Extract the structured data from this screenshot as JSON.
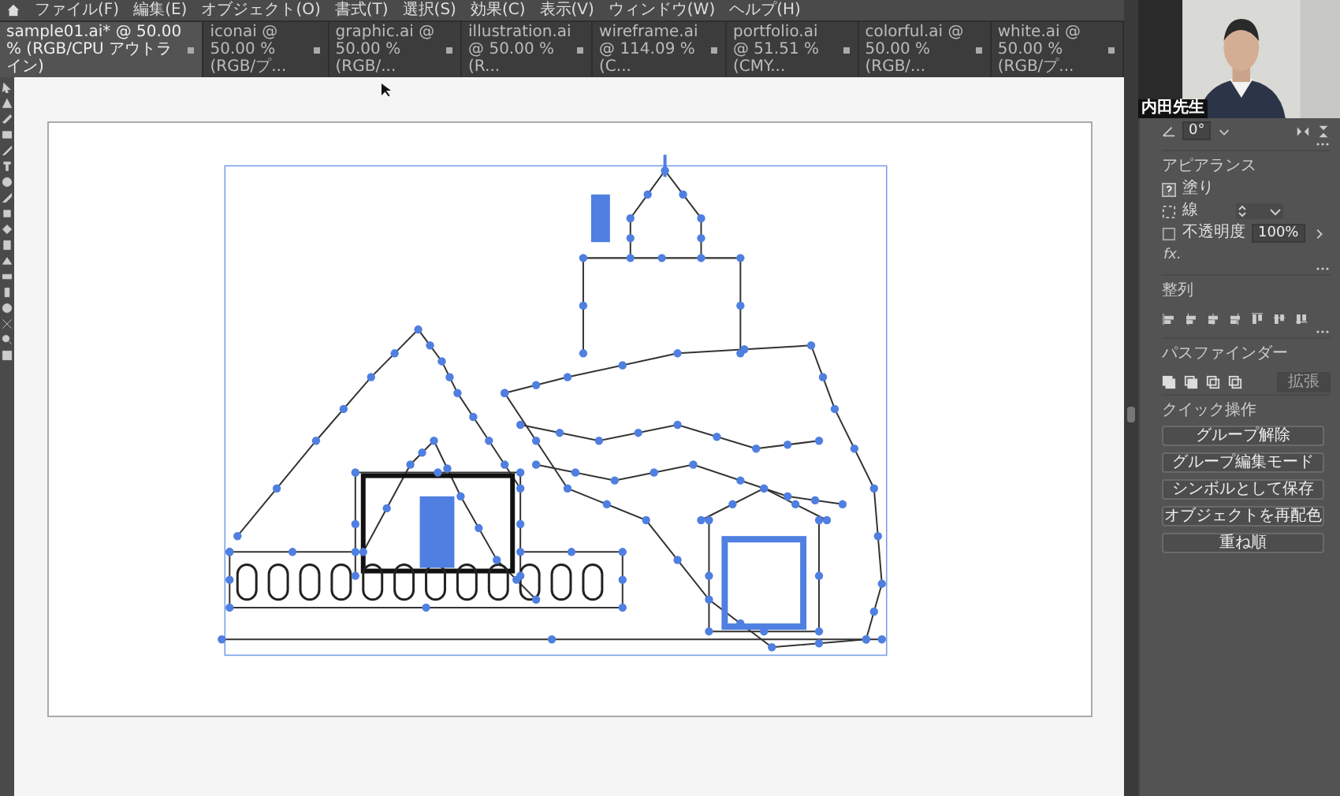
{
  "menu_bar": {
    "items": [
      "ファイル(F)",
      "編集(E)",
      "オブジェクト(O)",
      "書式(T)",
      "選択(S)",
      "効果(C)",
      "表示(V)",
      "ウィンドウ(W)",
      "ヘルプ(H)"
    ]
  },
  "document_tabs": [
    {
      "label": "sample01.ai* @ 50.00 % (RGB/CPU アウトライン)",
      "selected": true
    },
    {
      "label": "iconai @ 50.00 % (RGB/プ...",
      "selected": false
    },
    {
      "label": "graphic.ai @ 50.00 % (RGB/...",
      "selected": false
    },
    {
      "label": "illustration.ai @ 50.00 % (R...",
      "selected": false
    },
    {
      "label": "wireframe.ai @ 114.09 % (C...",
      "selected": false
    },
    {
      "label": "portfolio.ai @ 51.51 % (CMY...",
      "selected": false
    },
    {
      "label": "colorful.ai @ 50.00 % (RGB/...",
      "selected": false
    },
    {
      "label": "white.ai @ 50.00 % (RGB/プ...",
      "selected": false
    }
  ],
  "webcam": {
    "name_label": "内田先生"
  },
  "properties_panel": {
    "transform": {
      "rotation": "0°"
    },
    "appearance": {
      "title": "アピアランス",
      "fill_label": "塗り",
      "stroke_label": "線",
      "opacity_label": "不透明度",
      "opacity": "100%",
      "fx": "fx."
    },
    "align": {
      "title": "整列"
    },
    "pathfinder": {
      "title": "パスファインダー",
      "expand_button": {
        "label": "拡張",
        "disabled": true
      }
    },
    "quick_actions": {
      "title": "クイック操作",
      "buttons": [
        "グループ解除",
        "グループ編集モード",
        "シンボルとして保存",
        "オブジェクトを再配色",
        "重ね順"
      ]
    }
  }
}
